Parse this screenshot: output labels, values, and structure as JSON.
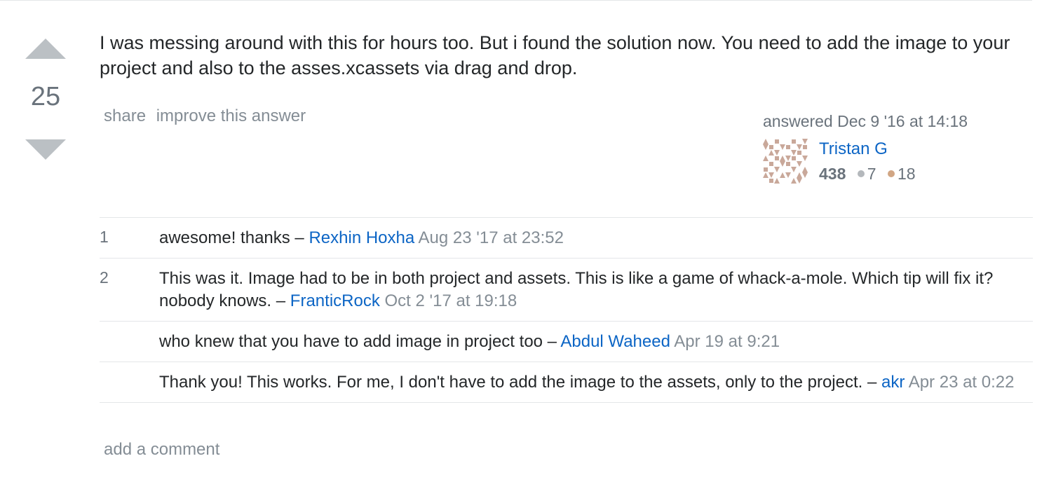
{
  "vote": {
    "count": "25"
  },
  "answer": {
    "body": "I was messing around with this for hours too. But i found the solution now. You need to add the image to your project and also to the asses.xcassets via drag and drop.",
    "menu": {
      "share_label": "share",
      "improve_label": "improve this answer"
    }
  },
  "user": {
    "action_time": "answered Dec 9 '16 at 14:18",
    "name": "Tristan G",
    "reputation": "438",
    "silver_badges": "7",
    "bronze_badges": "18",
    "colors": {
      "silver": "#b4b8bc",
      "bronze": "#d1a684",
      "avatar": "#c9a89a"
    }
  },
  "comments": [
    {
      "score": "1",
      "text": "awesome! thanks",
      "separator": " – ",
      "user": "Rexhin Hoxha",
      "date": "Aug 23 '17 at 23:52"
    },
    {
      "score": "2",
      "text": "This was it. Image had to be in both project and assets. This is like a game of whack-a-mole. Which tip will fix it? nobody knows.",
      "separator": " – ",
      "user": "FranticRock",
      "date": "Oct 2 '17 at 19:18"
    },
    {
      "score": "",
      "text": "who knew that you have to add image in project too",
      "separator": " – ",
      "user": "Abdul Waheed",
      "date": "Apr 19 at 9:21"
    },
    {
      "score": "",
      "text": "Thank you! This works. For me, I don't have to add the image to the assets, only to the project.",
      "separator": " – ",
      "user": "akr",
      "date": "Apr 23 at 0:22"
    }
  ],
  "add_comment_label": "add a comment"
}
